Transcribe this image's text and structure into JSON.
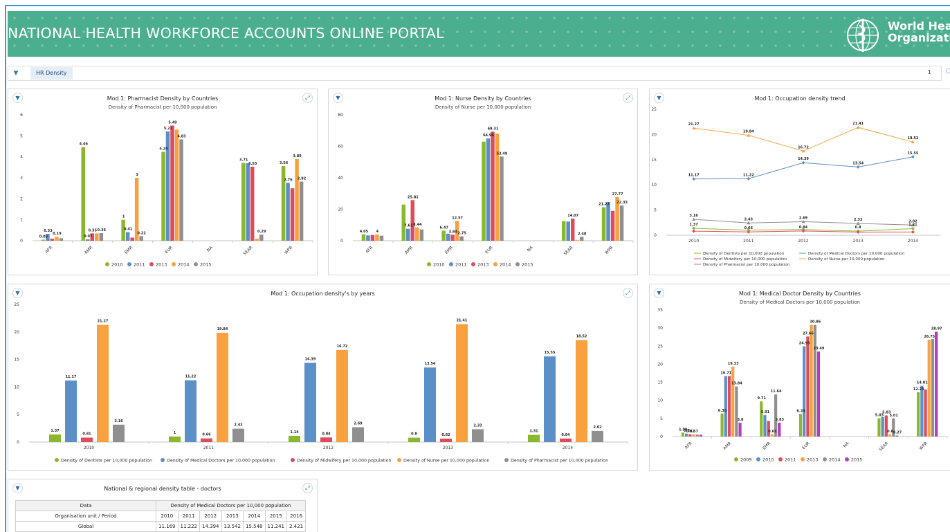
{
  "header": {
    "title": "NATIONAL HEALTH WORKFORCE ACCOUNTS ONLINE PORTAL",
    "logo_line1": "World Health",
    "logo_line2": "Organization",
    "banner_color": "#4aae8f"
  },
  "filter_bar": {
    "filter_icon": "funnel-icon",
    "chip_label": "HR Density",
    "count": "1"
  },
  "colors": {
    "y2009": "#8ab82c",
    "y2010_green": "#8ab82c",
    "blue": "#5b8fc7",
    "red": "#dc4c5b",
    "orange": "#f8a13e",
    "gray": "#8f8f8f",
    "purple": "#b23dbf"
  },
  "panels": {
    "pharmacist": {
      "title": "Mod 1: Pharmacist Density by Countries",
      "subtitle": "Density of Pharmacist per 10,000 population",
      "chart_data": {
        "type": "bar",
        "categories": [
          "AFR",
          "AMR",
          "EMR",
          "EUR",
          "NA",
          "SEAR",
          "WPR"
        ],
        "ylim": [
          0,
          6
        ],
        "yticks": [
          0,
          1,
          2,
          3,
          4,
          5,
          6
        ],
        "series": [
          {
            "name": "2010",
            "color": "#8ab82c",
            "values": [
              0.05,
              4.46,
              1,
              4.24,
              null,
              3.71,
              3.56
            ]
          },
          {
            "name": "2011",
            "color": "#5b8fc7",
            "values": [
              0.33,
              0.07,
              0.41,
              5.21,
              null,
              3.7,
              2.76
            ]
          },
          {
            "name": "2013",
            "color": "#dc4c5b",
            "values": [
              0.1,
              0.35,
              0.15,
              5.49,
              null,
              3.53,
              2.5
            ]
          },
          {
            "name": "2014",
            "color": "#f8a13e",
            "values": [
              0.19,
              0.35,
              3,
              5.3,
              null,
              0.1,
              3.89
            ]
          },
          {
            "name": "2015",
            "color": "#8f8f8f",
            "values": [
              0.12,
              0.36,
              0.22,
              4.83,
              null,
              0.29,
              2.82
            ]
          }
        ],
        "data_labels": [
          {
            "cat": 0,
            "s": 0,
            "text": "0.05"
          },
          {
            "cat": 0,
            "s": 1,
            "text": "0.33"
          },
          {
            "cat": 0,
            "s": 3,
            "text": "0.19"
          },
          {
            "cat": 1,
            "s": 0,
            "text": "4.46"
          },
          {
            "cat": 1,
            "s": 1,
            "text": "0.07"
          },
          {
            "cat": 1,
            "s": 2,
            "text": "0.35"
          },
          {
            "cat": 1,
            "s": 4,
            "text": "0.36"
          },
          {
            "cat": 2,
            "s": 0,
            "text": "1"
          },
          {
            "cat": 2,
            "s": 1,
            "text": "0.41"
          },
          {
            "cat": 2,
            "s": 3,
            "text": "3"
          },
          {
            "cat": 2,
            "s": 4,
            "text": "0.22"
          },
          {
            "cat": 3,
            "s": 0,
            "text": "4.24"
          },
          {
            "cat": 3,
            "s": 1,
            "text": "5.21"
          },
          {
            "cat": 3,
            "s": 2,
            "text": "5.49"
          },
          {
            "cat": 3,
            "s": 4,
            "text": "4.83"
          },
          {
            "cat": 5,
            "s": 0,
            "text": "3.71"
          },
          {
            "cat": 5,
            "s": 2,
            "text": "3.53"
          },
          {
            "cat": 5,
            "s": 4,
            "text": "0.29"
          },
          {
            "cat": 6,
            "s": 0,
            "text": "3.56"
          },
          {
            "cat": 6,
            "s": 1,
            "text": "2.76"
          },
          {
            "cat": 6,
            "s": 3,
            "text": "3.89"
          },
          {
            "cat": 6,
            "s": 4,
            "text": "2.82"
          }
        ],
        "legend_position": "bottom"
      }
    },
    "nurse": {
      "title": "Mod 1: Nurse Density by Countries",
      "subtitle": "Density of Nurse per 10,000 population",
      "chart_data": {
        "type": "bar",
        "categories": [
          "AFR",
          "AMR",
          "EMR",
          "EUR",
          "NA",
          "SEAR",
          "WPR"
        ],
        "ylim": [
          0,
          80
        ],
        "yticks": [
          0,
          20,
          40,
          60,
          80
        ],
        "series": [
          {
            "name": "2010",
            "color": "#8ab82c",
            "values": [
              4.05,
              23,
              6.47,
              63,
              null,
              12.5,
              21.27
            ]
          },
          {
            "name": "2011",
            "color": "#5b8fc7",
            "values": [
              3.4,
              7.61,
              4.5,
              64.96,
              null,
              12.2,
              24.5
            ]
          },
          {
            "name": "2013",
            "color": "#dc4c5b",
            "values": [
              3.6,
              25.81,
              3.84,
              69.31,
              null,
              14.07,
              19
            ]
          },
          {
            "name": "2014",
            "color": "#f8a13e",
            "values": [
              4,
              8.44,
              12.57,
              68,
              null,
              0.4,
              27.77
            ]
          },
          {
            "name": "2015",
            "color": "#8f8f8f",
            "values": [
              3.2,
              7.2,
              2.75,
              53.49,
              null,
              2.48,
              22.33
            ]
          }
        ],
        "data_labels": [
          {
            "cat": 0,
            "s": 0,
            "text": "4.05"
          },
          {
            "cat": 0,
            "s": 3,
            "text": "4"
          },
          {
            "cat": 1,
            "s": 1,
            "text": "7.61"
          },
          {
            "cat": 1,
            "s": 2,
            "text": "25.81"
          },
          {
            "cat": 1,
            "s": 3,
            "text": "8.44"
          },
          {
            "cat": 2,
            "s": 0,
            "text": "6.47"
          },
          {
            "cat": 2,
            "s": 2,
            "text": "3.84"
          },
          {
            "cat": 2,
            "s": 3,
            "text": "12.57"
          },
          {
            "cat": 2,
            "s": 4,
            "text": "2.75"
          },
          {
            "cat": 3,
            "s": 1,
            "text": "64.96"
          },
          {
            "cat": 3,
            "s": 2,
            "text": "69.31"
          },
          {
            "cat": 3,
            "s": 4,
            "text": "53.49"
          },
          {
            "cat": 5,
            "s": 2,
            "text": "14.07"
          },
          {
            "cat": 5,
            "s": 4,
            "text": "2.48"
          },
          {
            "cat": 6,
            "s": 0,
            "text": "21.27"
          },
          {
            "cat": 6,
            "s": 3,
            "text": "27.77"
          },
          {
            "cat": 6,
            "s": 4,
            "text": "22.33"
          }
        ],
        "legend_position": "bottom"
      }
    },
    "trend": {
      "title": "Mod 1: Occupation density trend",
      "chart_data": {
        "type": "line",
        "x": [
          "2010",
          "2011",
          "2012",
          "2013",
          "2014"
        ],
        "ylim": [
          0,
          25
        ],
        "yticks": [
          0,
          5,
          10,
          15,
          20,
          25
        ],
        "series": [
          {
            "name": "Density of Dentists per 10,000 population",
            "color": "#8ab82c",
            "values": [
              1.37,
              1,
              1.14,
              0.8,
              1.31
            ],
            "marker": "diamond"
          },
          {
            "name": "Density of Medical Doctors per 10,000 population",
            "color": "#5b8fc7",
            "values": [
              11.17,
              11.22,
              14.39,
              13.54,
              15.55
            ],
            "marker": "diamond"
          },
          {
            "name": "Density of Midwifery per 10,000 population",
            "color": "#dc4c5b",
            "values": [
              0.81,
              0.66,
              0.84,
              0.62,
              0.64
            ],
            "marker": "diamond"
          },
          {
            "name": "Density of Nurse per 10,000 population",
            "color": "#f8a13e",
            "values": [
              21.27,
              19.84,
              16.72,
              21.41,
              18.52
            ],
            "marker": "triangle"
          },
          {
            "name": "Density of Pharmacist per 10,000 population",
            "color": "#8f8f8f",
            "values": [
              3.16,
              2.43,
              2.69,
              2.33,
              2.02
            ],
            "marker": "triangle"
          }
        ],
        "data_labels": [
          {
            "s": 3,
            "i": 0,
            "text": "21.27"
          },
          {
            "s": 3,
            "i": 1,
            "text": "19.84"
          },
          {
            "s": 3,
            "i": 2,
            "text": "16.72"
          },
          {
            "s": 3,
            "i": 3,
            "text": "21.41"
          },
          {
            "s": 3,
            "i": 4,
            "text": "18.52"
          },
          {
            "s": 1,
            "i": 0,
            "text": "11.17"
          },
          {
            "s": 1,
            "i": 1,
            "text": "11.22"
          },
          {
            "s": 1,
            "i": 2,
            "text": "14.39"
          },
          {
            "s": 1,
            "i": 3,
            "text": "13.54"
          },
          {
            "s": 1,
            "i": 4,
            "text": "15.55"
          },
          {
            "s": 4,
            "i": 0,
            "text": "3.16"
          },
          {
            "s": 4,
            "i": 1,
            "text": "2.43"
          },
          {
            "s": 4,
            "i": 2,
            "text": "2.69"
          },
          {
            "s": 4,
            "i": 3,
            "text": "2.33"
          },
          {
            "s": 4,
            "i": 4,
            "text": "2.02"
          },
          {
            "s": 0,
            "i": 0,
            "text": "1.37"
          },
          {
            "s": 2,
            "i": 1,
            "text": "0.66"
          },
          {
            "s": 2,
            "i": 2,
            "text": "0.84"
          },
          {
            "s": 0,
            "i": 3,
            "text": "0.8"
          },
          {
            "s": 0,
            "i": 4,
            "text": "1.31"
          }
        ],
        "legend_position": "bottom"
      }
    },
    "years": {
      "title": "Mod 1: Occupation density's by years",
      "chart_data": {
        "type": "bar",
        "categories": [
          "2010",
          "2011",
          "2012",
          "2013",
          "2014"
        ],
        "ylim": [
          0,
          25
        ],
        "yticks": [
          0,
          5,
          10,
          15,
          20,
          25
        ],
        "series": [
          {
            "name": "Density of Dentists per 10,000 population",
            "color": "#8ab82c",
            "values": [
              1.37,
              1,
              1.14,
              0.8,
              1.31
            ]
          },
          {
            "name": "Density of Medical Doctors per 10,000 population",
            "color": "#5b8fc7",
            "values": [
              11.17,
              11.22,
              14.39,
              13.54,
              15.55
            ]
          },
          {
            "name": "Density of Midwifery per 10,000 population",
            "color": "#dc4c5b",
            "values": [
              0.81,
              0.66,
              0.84,
              0.62,
              0.64
            ]
          },
          {
            "name": "Density of Nurse per 10,000 population",
            "color": "#f8a13e",
            "values": [
              21.27,
              19.84,
              16.72,
              21.41,
              18.52
            ]
          },
          {
            "name": "Density of Pharmacist per 10,000 population",
            "color": "#8f8f8f",
            "values": [
              3.16,
              2.43,
              2.69,
              2.33,
              2.02
            ]
          }
        ],
        "legend_position": "bottom"
      }
    },
    "doctor": {
      "title": "Mod 1: Medical Doctor Density by Countries",
      "subtitle": "Density of Medical Doctors per 10,000 population",
      "chart_data": {
        "type": "bar",
        "categories": [
          "AFR",
          "AMR",
          "EMR",
          "EUR",
          "NA",
          "SEAR",
          "WPR"
        ],
        "ylim": [
          0,
          35
        ],
        "yticks": [
          0,
          5,
          10,
          15,
          20,
          25,
          30,
          35
        ],
        "series": [
          {
            "name": "2009",
            "color": "#8ab82c",
            "values": [
              1.09,
              6.35,
              9.71,
              6.24,
              null,
              5.03,
              12.23
            ]
          },
          {
            "name": "2010",
            "color": "#5b8fc7",
            "values": [
              0.8,
              16.71,
              5.91,
              24.95,
              null,
              5.4,
              14.01
            ]
          },
          {
            "name": "2011",
            "color": "#dc4c5b",
            "values": [
              0.62,
              16.71,
              4.3,
              27.66,
              null,
              5.83,
              13
            ]
          },
          {
            "name": "2013",
            "color": "#f8a13e",
            "values": [
              0.57,
              19.33,
              0.61,
              30.86,
              null,
              0.6,
              26.75
            ]
          },
          {
            "name": "2014",
            "color": "#8f8f8f",
            "values": [
              0.55,
              13.84,
              11.64,
              30.86,
              null,
              5.01,
              27
            ]
          },
          {
            "name": "2015",
            "color": "#b23dbf",
            "values": [
              0.5,
              3.8,
              3.83,
              23.49,
              null,
              0.27,
              28.97
            ]
          }
        ],
        "data_labels": [
          {
            "cat": 0,
            "s": 0,
            "text": "1.09"
          },
          {
            "cat": 0,
            "s": 1,
            "text": "0.8"
          },
          {
            "cat": 0,
            "s": 2,
            "text": "0.62"
          },
          {
            "cat": 0,
            "s": 3,
            "text": "0.57"
          },
          {
            "cat": 1,
            "s": 0,
            "text": "6.35"
          },
          {
            "cat": 1,
            "s": 1,
            "text": "16.71"
          },
          {
            "cat": 1,
            "s": 3,
            "text": "19.33"
          },
          {
            "cat": 1,
            "s": 4,
            "text": "13.84"
          },
          {
            "cat": 1,
            "s": 5,
            "text": "3.8"
          },
          {
            "cat": 2,
            "s": 0,
            "text": "9.71"
          },
          {
            "cat": 2,
            "s": 1,
            "text": "5.91"
          },
          {
            "cat": 2,
            "s": 3,
            "text": "0.61"
          },
          {
            "cat": 2,
            "s": 4,
            "text": "11.64"
          },
          {
            "cat": 2,
            "s": 5,
            "text": "3.83"
          },
          {
            "cat": 3,
            "s": 0,
            "text": "6.24"
          },
          {
            "cat": 3,
            "s": 1,
            "text": "24.95"
          },
          {
            "cat": 3,
            "s": 2,
            "text": "27.66"
          },
          {
            "cat": 3,
            "s": 4,
            "text": "30.86"
          },
          {
            "cat": 3,
            "s": 5,
            "text": "23.49"
          },
          {
            "cat": 5,
            "s": 0,
            "text": "5.03"
          },
          {
            "cat": 5,
            "s": 2,
            "text": "5.83"
          },
          {
            "cat": 5,
            "s": 3,
            "text": "0.6"
          },
          {
            "cat": 5,
            "s": 4,
            "text": "5.01"
          },
          {
            "cat": 5,
            "s": 5,
            "text": "0.27"
          },
          {
            "cat": 6,
            "s": 0,
            "text": "12.23"
          },
          {
            "cat": 6,
            "s": 1,
            "text": "14.01"
          },
          {
            "cat": 6,
            "s": 3,
            "text": "26.75"
          },
          {
            "cat": 6,
            "s": 5,
            "text": "28.97"
          }
        ],
        "legend_position": "bottom"
      }
    },
    "table": {
      "title": "National & regional density table - doctors",
      "data_header": "Data",
      "measure_header": "Density of Medical Doctors per 10,000 population",
      "row_header": "Organisation unit / Period",
      "periods": [
        "2010",
        "2011",
        "2012",
        "2013",
        "2014",
        "2015",
        "2016"
      ],
      "rows": [
        {
          "label": "Global",
          "values": [
            "11.169",
            "11.222",
            "14.394",
            "13.542",
            "15.548",
            "11.241",
            "2.421"
          ]
        }
      ]
    }
  }
}
